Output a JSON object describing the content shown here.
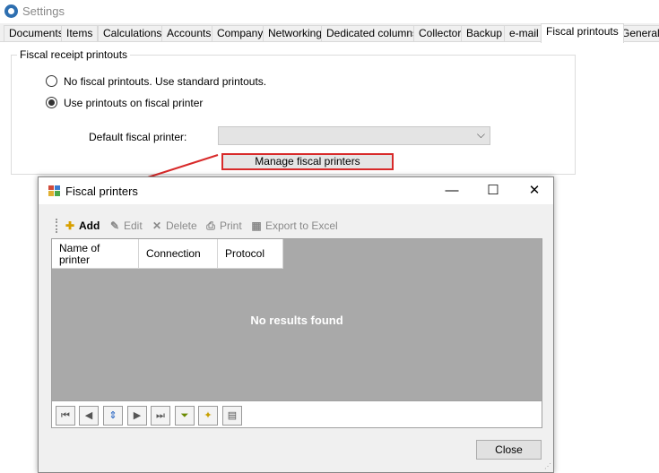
{
  "window": {
    "title": "Settings",
    "icon": "settings-gear-icon"
  },
  "tabs": [
    {
      "label": "Documents"
    },
    {
      "label": "Items"
    },
    {
      "label": "Calculations"
    },
    {
      "label": "Accounts"
    },
    {
      "label": "Company"
    },
    {
      "label": "Networking"
    },
    {
      "label": "Dedicated columns"
    },
    {
      "label": "Collector"
    },
    {
      "label": "Backup"
    },
    {
      "label": "e-mail"
    },
    {
      "label": "Fiscal printouts"
    },
    {
      "label": "General"
    }
  ],
  "active_tab": "Fiscal printouts",
  "group": {
    "title": "Fiscal receipt printouts",
    "option_standard": "No fiscal printouts. Use standard printouts.",
    "option_fiscal": "Use printouts on fiscal printer",
    "selected_option": "Use printouts on fiscal printer",
    "default_printer_label": "Default fiscal printer:",
    "default_printer_value": "",
    "manage_button": "Manage fiscal printers"
  },
  "annotation": {
    "color": "#d82a2a"
  },
  "dialog": {
    "title": "Fiscal printers",
    "icon": "fiscal-printer-icon",
    "toolbar": {
      "add": "Add",
      "edit": "Edit",
      "delete": "Delete",
      "print": "Print",
      "export": "Export to Excel"
    },
    "columns": [
      "Name of printer",
      "Connection",
      "Protocol"
    ],
    "rows": [],
    "empty_message": "No results found",
    "navigator": [
      "first-record-icon",
      "prev-record-icon",
      "sort-icon",
      "next-record-icon",
      "last-record-icon",
      "filter-icon",
      "lightbulbs-icon",
      "grid-settings-icon"
    ],
    "close_button": "Close"
  }
}
